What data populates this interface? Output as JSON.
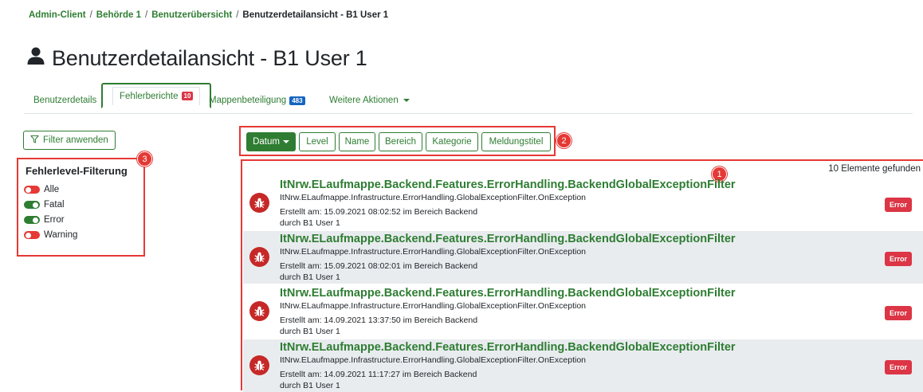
{
  "breadcrumb": {
    "items": [
      "Admin-Client",
      "Behörde 1",
      "Benutzerübersicht"
    ],
    "current": "Benutzerdetailansicht - B1 User 1",
    "separator": "/"
  },
  "page": {
    "title": "Benutzerdetailansicht - B1 User 1",
    "title_icon": "user-icon"
  },
  "tabs": [
    {
      "label": "Benutzerdetails"
    },
    {
      "label": "Fehlerberichte",
      "badge": "10",
      "active": true
    },
    {
      "label": "Mappenbeteiligung",
      "badge": "483"
    },
    {
      "label": "Weitere Aktionen",
      "dropdown": true
    }
  ],
  "filter": {
    "apply_label": "Filter anwenden",
    "heading": "Fehlerlevel-Filterung",
    "levels": [
      {
        "label": "Alle",
        "enabled": false
      },
      {
        "label": "Fatal",
        "enabled": true
      },
      {
        "label": "Error",
        "enabled": true
      },
      {
        "label": "Warning",
        "enabled": false
      }
    ]
  },
  "sort": {
    "buttons": [
      "Datum",
      "Level",
      "Name",
      "Bereich",
      "Kategorie",
      "Meldungstitel"
    ],
    "active": "Datum"
  },
  "results": {
    "count_text": "10 Elemente gefunden",
    "entries": [
      {
        "title": "ItNrw.ELaufmappe.Backend.Features.ErrorHandling.BackendGlobalExceptionFilter",
        "source": "ItNrw.ELaufmappe.Infrastructure.ErrorHandling.GlobalExceptionFilter.OnException",
        "created": "Erstellt am: 15.09.2021 08:02:52 im Bereich Backend",
        "by": "durch B1 User 1",
        "level": "Error"
      },
      {
        "title": "ItNrw.ELaufmappe.Backend.Features.ErrorHandling.BackendGlobalExceptionFilter",
        "source": "ItNrw.ELaufmappe.Infrastructure.ErrorHandling.GlobalExceptionFilter.OnException",
        "created": "Erstellt am: 15.09.2021 08:02:01 im Bereich Backend",
        "by": "durch B1 User 1",
        "level": "Error"
      },
      {
        "title": "ItNrw.ELaufmappe.Backend.Features.ErrorHandling.BackendGlobalExceptionFilter",
        "source": "ItNrw.ELaufmappe.Infrastructure.ErrorHandling.GlobalExceptionFilter.OnException",
        "created": "Erstellt am: 14.09.2021 13:37:50 im Bereich Backend",
        "by": "durch B1 User 1",
        "level": "Error"
      },
      {
        "title": "ItNrw.ELaufmappe.Backend.Features.ErrorHandling.BackendGlobalExceptionFilter",
        "source": "ItNrw.ELaufmappe.Infrastructure.ErrorHandling.GlobalExceptionFilter.OnException",
        "created": "Erstellt am: 14.09.2021 11:17:27 im Bereich Backend",
        "by": "durch B1 User 1",
        "level": "Error"
      }
    ]
  },
  "annotations": [
    "1",
    "2",
    "3"
  ],
  "colors": {
    "accent": "#2e7d32",
    "danger": "#dc3545",
    "highlight": "#e53935",
    "info_badge": "#1565c0"
  }
}
